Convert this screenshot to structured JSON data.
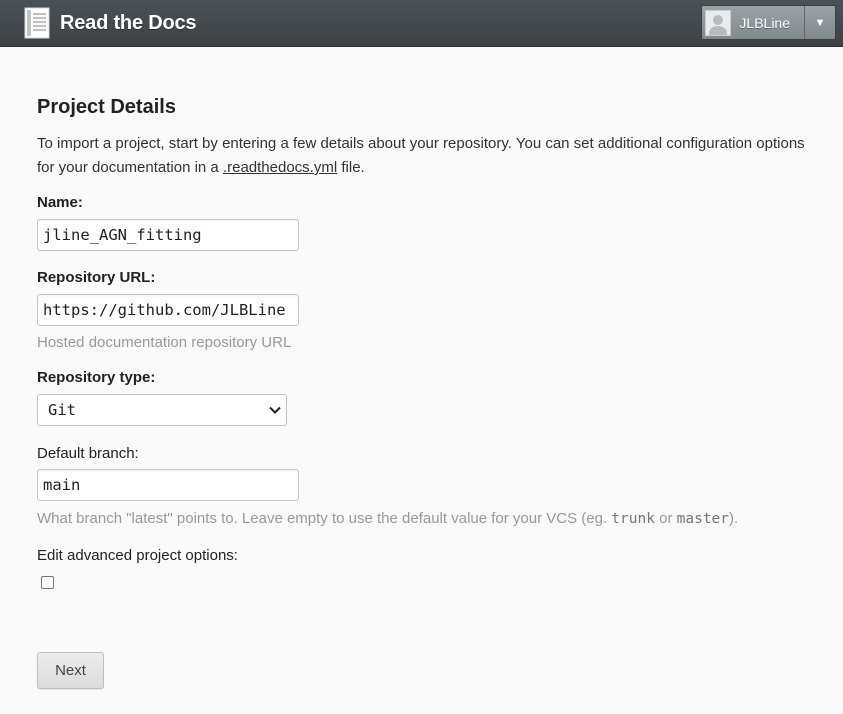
{
  "header": {
    "brand": "Read the Docs",
    "brand_icon": "book-icon",
    "user": {
      "name": "JLBLine",
      "avatar_icon": "avatar-icon",
      "dropdown_icon": "caret-down-icon",
      "dropdown_glyph": "▼"
    }
  },
  "main": {
    "title": "Project Details",
    "intro": {
      "before_link": "To import a project, start by entering a few details about your repository. You can set additional configuration options for your documentation in a ",
      "link_text": ".readthedocs.yml",
      "after_link": " file."
    },
    "fields": {
      "name": {
        "label": "Name:",
        "value": "jline_AGN_fitting"
      },
      "repo_url": {
        "label": "Repository URL:",
        "value": "https://github.com/JLBLine",
        "help": "Hosted documentation repository URL"
      },
      "repo_type": {
        "label": "Repository type:",
        "selected": "Git",
        "chevron_icon": "chevron-down-icon"
      },
      "default_branch": {
        "label": "Default branch:",
        "value": "main",
        "help_before": "What branch \"latest\" points to. Leave empty to use the default value for your VCS (eg. ",
        "help_code1": "trunk",
        "help_mid": " or ",
        "help_code2": "master",
        "help_after": ")."
      },
      "advanced": {
        "label": "Edit advanced project options:",
        "checked": false
      }
    },
    "next_button": "Next"
  },
  "colors": {
    "header_bg": "#42484c",
    "page_bg": "#fafafa",
    "help_text": "#999999"
  }
}
